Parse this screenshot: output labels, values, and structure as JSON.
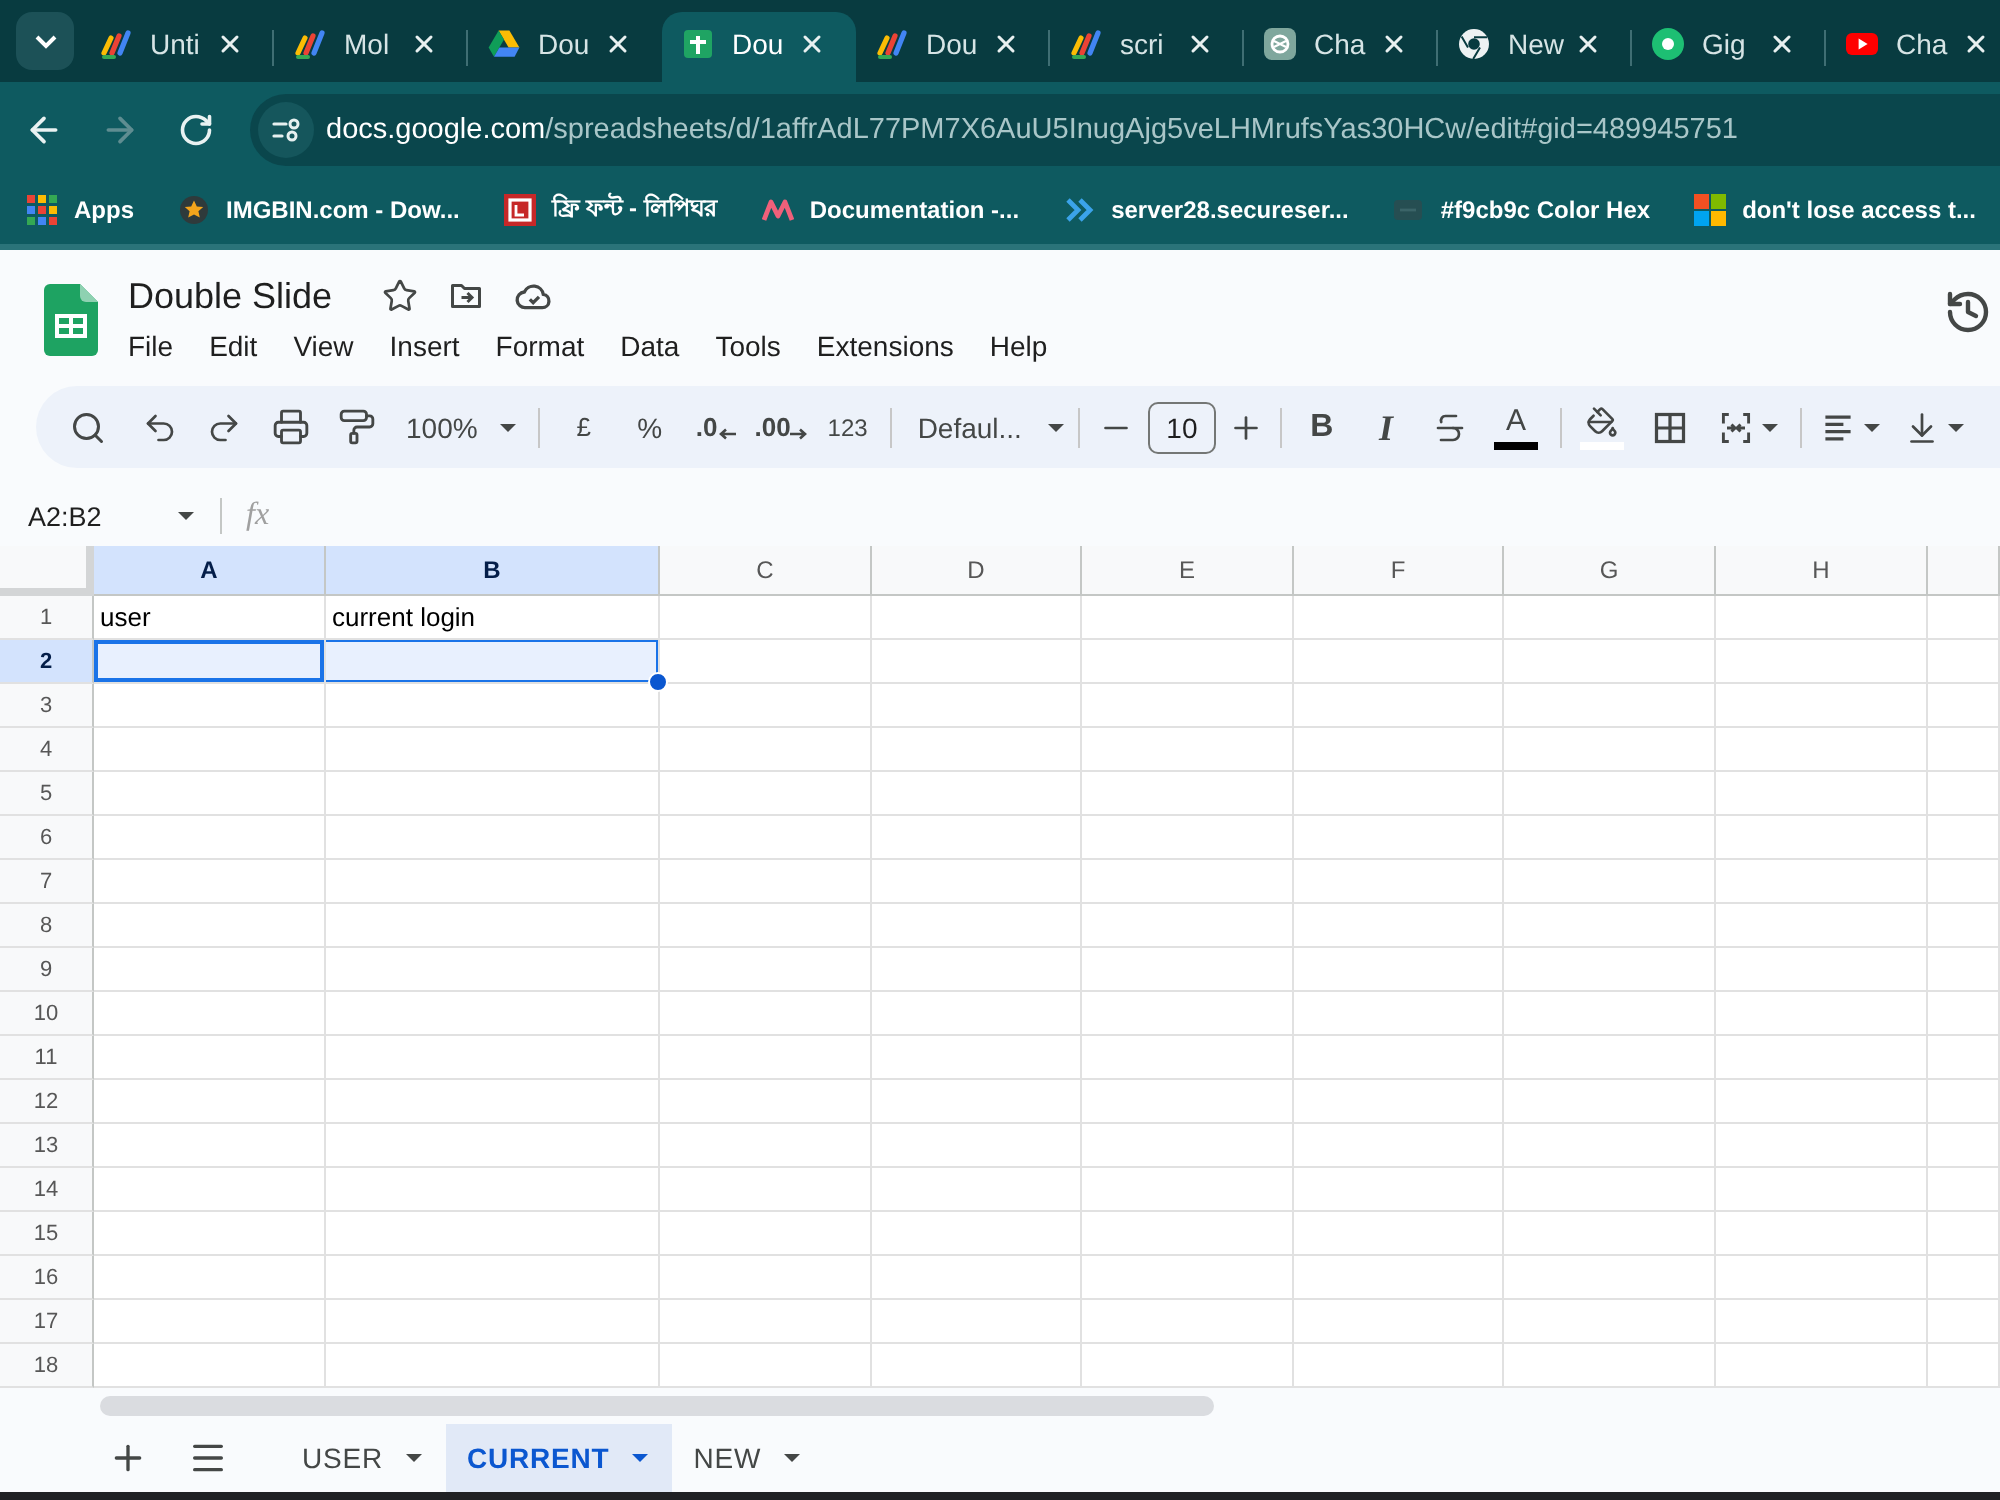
{
  "browser": {
    "tabs": [
      {
        "title": "Unti",
        "kind": "pinwheel",
        "selected": false
      },
      {
        "title": "Mol",
        "kind": "pinwheel",
        "selected": false
      },
      {
        "title": "Dou",
        "kind": "triangle",
        "selected": false
      },
      {
        "title": "Dou",
        "kind": "sheet",
        "selected": true
      },
      {
        "title": "Dou",
        "kind": "pinwheel",
        "selected": false
      },
      {
        "title": "scri",
        "kind": "pinwheel",
        "selected": false
      },
      {
        "title": "Cha",
        "kind": "knot",
        "selected": false
      },
      {
        "title": "New",
        "kind": "ring",
        "selected": false
      },
      {
        "title": "Gig",
        "kind": "disc",
        "selected": false
      },
      {
        "title": "Cha",
        "kind": "play",
        "selected": false
      }
    ],
    "navigation": [
      {
        "kind": "back",
        "disabled": false
      },
      {
        "kind": "forward",
        "disabled": true
      },
      {
        "kind": "reload",
        "disabled": false
      }
    ],
    "address": {
      "host": "docs.google.com",
      "path": "/spreadsheets/d/1affrAdL77PM7X6AuU5InugAjg5veLHMrufsYas30HCw/edit#gid=489945751"
    },
    "bookmarks": [
      {
        "label": "Apps",
        "kind": "grid"
      },
      {
        "label": "IMGBIN.com - Dow...",
        "kind": "star"
      },
      {
        "label": "ফ্রি ফন্ট - লিপিঘর",
        "kind": "tile"
      },
      {
        "label": "Documentation -...",
        "kind": "zigzag"
      },
      {
        "label": "server28.secureser...",
        "kind": "chevrons"
      },
      {
        "label": "#f9cb9c Color Hex",
        "kind": "faint"
      },
      {
        "label": "don't lose access t...",
        "kind": "windows"
      }
    ]
  },
  "document": {
    "title": "Double Slide",
    "menu": [
      "File",
      "Edit",
      "View",
      "Insert",
      "Format",
      "Data",
      "Tools",
      "Extensions",
      "Help"
    ]
  },
  "toolbar": {
    "zoom": "100%",
    "currency": "£",
    "percent": "%",
    "decrease_decimals": ".0",
    "increase_decimals": ".00",
    "number_format": "123",
    "font": "Defaul...",
    "font_size": "10",
    "bold": "B",
    "italic": "I",
    "text_color": "A"
  },
  "formula_bar": {
    "name_box": "A2:B2",
    "formula_label": "fx"
  },
  "grid": {
    "columns": [
      {
        "label": "A",
        "selected": true
      },
      {
        "label": "B",
        "selected": true
      },
      {
        "label": "C",
        "selected": false
      },
      {
        "label": "D",
        "selected": false
      },
      {
        "label": "E",
        "selected": false
      },
      {
        "label": "F",
        "selected": false
      },
      {
        "label": "G",
        "selected": false
      },
      {
        "label": "H",
        "selected": false
      }
    ],
    "rows": [
      {
        "label": "1",
        "selected": false,
        "cells": [
          "user",
          "current login"
        ]
      },
      {
        "label": "2",
        "selected": true
      },
      {
        "label": "3",
        "selected": false
      },
      {
        "label": "4",
        "selected": false
      },
      {
        "label": "5",
        "selected": false
      },
      {
        "label": "6",
        "selected": false
      },
      {
        "label": "7",
        "selected": false
      },
      {
        "label": "8",
        "selected": false
      },
      {
        "label": "9",
        "selected": false
      },
      {
        "label": "10",
        "selected": false
      },
      {
        "label": "11",
        "selected": false
      },
      {
        "label": "12",
        "selected": false
      },
      {
        "label": "13",
        "selected": false
      },
      {
        "label": "14",
        "selected": false
      },
      {
        "label": "15",
        "selected": false
      },
      {
        "label": "16",
        "selected": false
      },
      {
        "label": "17",
        "selected": false
      },
      {
        "label": "18",
        "selected": false
      }
    ]
  },
  "sheet_tabs": [
    {
      "label": "USER",
      "selected": false
    },
    {
      "label": "CURRENT",
      "selected": true
    },
    {
      "label": "NEW",
      "selected": false
    }
  ]
}
